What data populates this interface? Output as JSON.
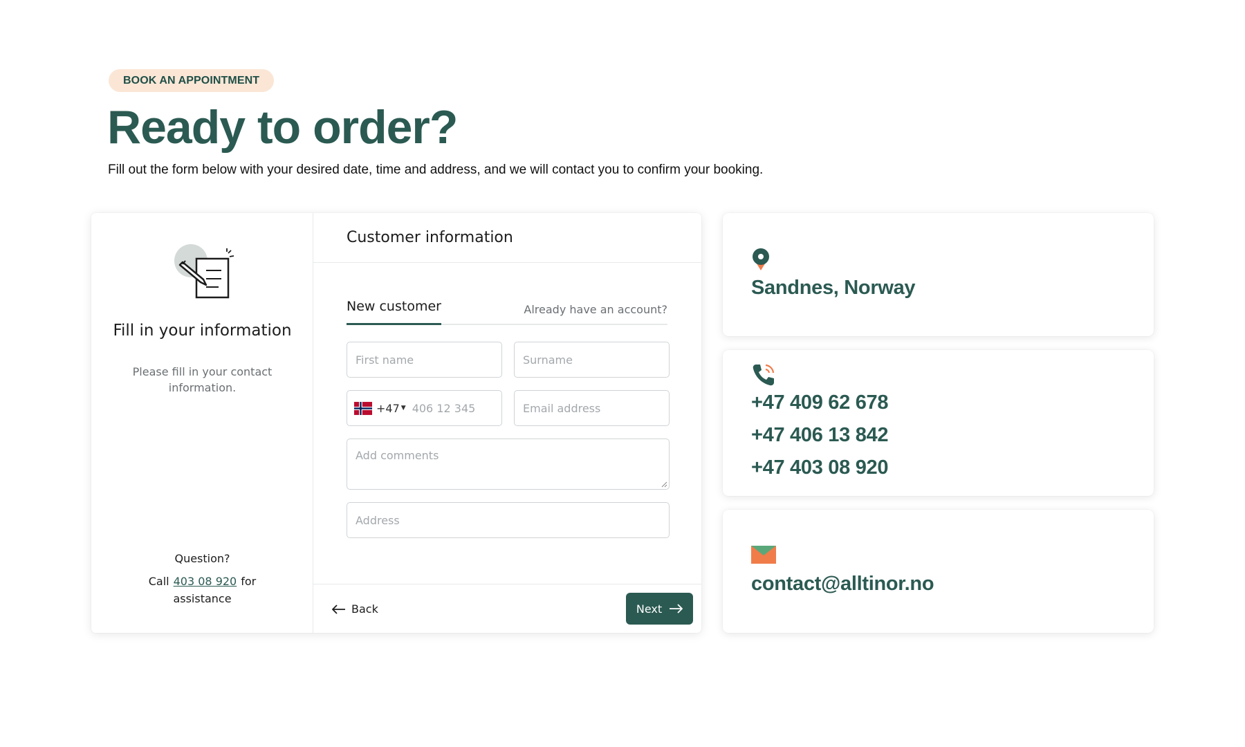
{
  "header": {
    "eyebrow": "BOOK AN APPOINTMENT",
    "title": "Ready to order?",
    "subtitle": "Fill out the form below with your desired date, time and address, and we will contact you to confirm your booking."
  },
  "step": {
    "title": "Fill in your information",
    "description": "Please fill in your contact information.",
    "help_question": "Question?",
    "help_prefix": "Call",
    "help_phone": "403 08 920",
    "help_suffix": "for assistance"
  },
  "form": {
    "heading": "Customer information",
    "tab_new": "New customer",
    "tab_existing": "Already have an account?",
    "first_name_placeholder": "First name",
    "surname_placeholder": "Surname",
    "country_code": "+47",
    "phone_placeholder": "406 12 345",
    "email_placeholder": "Email address",
    "comments_placeholder": "Add comments",
    "address_placeholder": "Address",
    "back_label": "Back",
    "next_label": "Next"
  },
  "contact": {
    "location": "Sandnes, Norway",
    "phones": [
      "+47 409 62 678",
      "+47 406 13 842",
      "+47 403 08 920"
    ],
    "email": "contact@alltinor.no"
  },
  "colors": {
    "brand_green": "#2b5a52",
    "eyebrow_bg": "#fbe6d6",
    "accent_orange": "#f07c4a"
  },
  "icons": [
    "pencil-document-icon",
    "location-pin-icon",
    "phone-icon",
    "mail-icon",
    "norway-flag-icon",
    "arrow-left-icon",
    "arrow-right-icon"
  ]
}
